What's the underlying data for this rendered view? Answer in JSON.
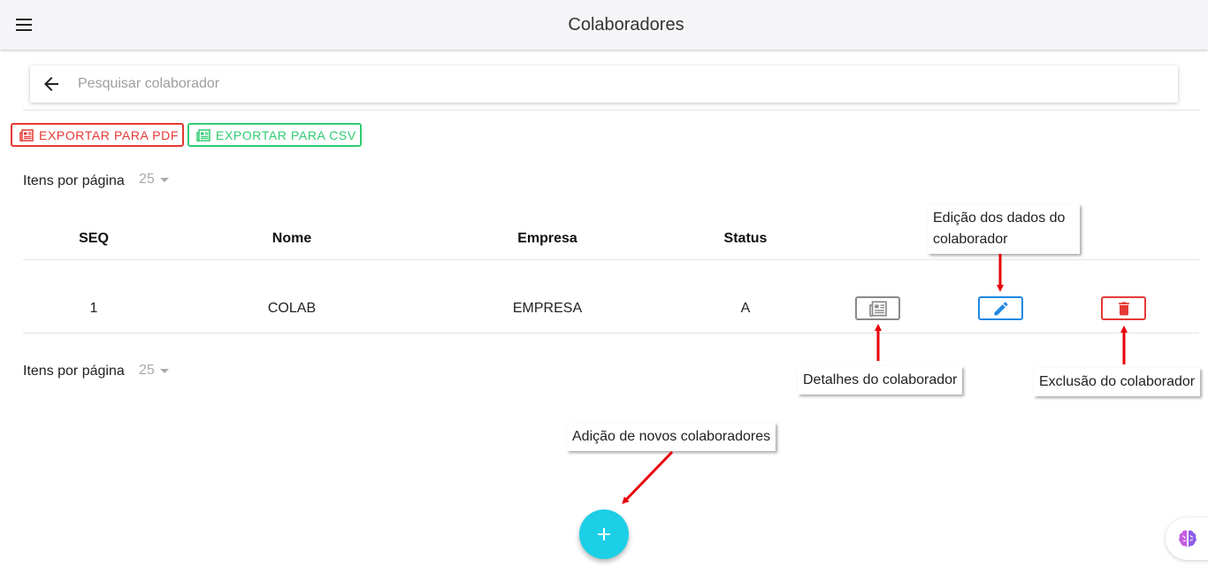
{
  "header": {
    "title": "Colaboradores",
    "menu_icon": "hamburger-menu-icon"
  },
  "search": {
    "placeholder": "Pesquisar colaborador",
    "back_icon": "arrow-left-icon"
  },
  "export": {
    "pdf_label": "EXPORTAR PARA PDF",
    "csv_label": "EXPORTAR PARA CSV",
    "pdf_color": "#e53935",
    "csv_color": "#2ecc71",
    "icon": "newspaper-icon"
  },
  "pagination": {
    "label": "Itens por página",
    "value": "25"
  },
  "table": {
    "columns": [
      "SEQ",
      "Nome",
      "Empresa",
      "Status"
    ],
    "rows": [
      {
        "seq": "1",
        "nome": "COLAB",
        "empresa": "EMPRESA",
        "status": "A"
      }
    ],
    "actions": {
      "detail_icon": "newspaper-icon",
      "edit_icon": "pencil-icon",
      "delete_icon": "trash-icon",
      "edit_color": "#1e88e5",
      "delete_color": "#e53935"
    }
  },
  "annotations": {
    "edit_line1": "Edição dos dados do",
    "edit_line2": "colaborador",
    "details": "Detalhes do colaborador",
    "delete": "Exclusão do colaborador",
    "add": "Adição de novos colaboradores",
    "arrow_color": "#e8000b"
  },
  "fab": {
    "icon": "plus-icon",
    "color": "#1ccfe6"
  },
  "corner_widget": {
    "icon": "brain-icon"
  }
}
